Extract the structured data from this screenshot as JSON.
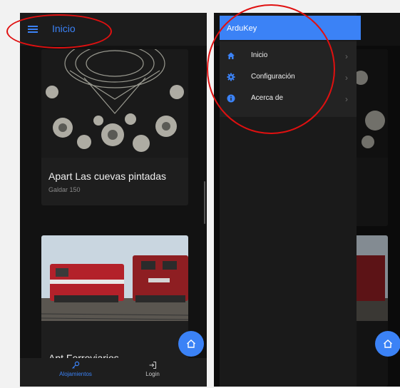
{
  "left": {
    "header": {
      "title": "Inicio"
    },
    "cards": [
      {
        "title": "Apart Las cuevas pintadas",
        "subtitle": "Galdar 150"
      },
      {
        "title": "Apt Ferroviarios",
        "subtitle": ""
      }
    ],
    "bottom_nav": [
      {
        "label": "Alojamientos",
        "icon": "key-icon"
      },
      {
        "label": "Login",
        "icon": "login-icon"
      }
    ]
  },
  "right": {
    "drawer": {
      "title": "ArduKey",
      "items": [
        {
          "label": "Inicio",
          "icon": "home-icon"
        },
        {
          "label": "Configuración",
          "icon": "gear-icon"
        },
        {
          "label": "Acerca de",
          "icon": "info-icon"
        }
      ]
    }
  },
  "colors": {
    "accent": "#3b82f6",
    "annotation": "#e01010",
    "background": "#121212"
  }
}
